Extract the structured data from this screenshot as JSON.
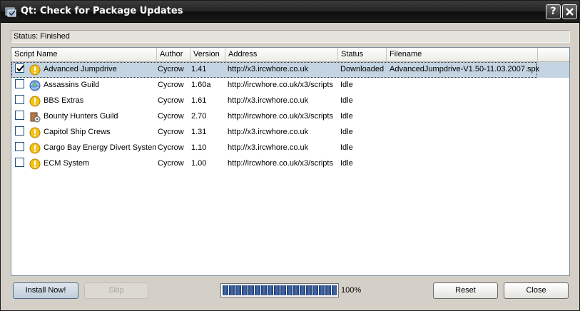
{
  "window": {
    "title": "Qt: Check for Package Updates"
  },
  "status_label": "Status: Finished",
  "columns": [
    "Script Name",
    "Author",
    "Version",
    "Address",
    "Status",
    "Filename"
  ],
  "rows": [
    {
      "checked": true,
      "icon": "info-icon",
      "name": "Advanced Jumpdrive",
      "author": "Cycrow",
      "version": "1.41",
      "address": "http://x3.ircwhore.co.uk",
      "status": "Downloaded",
      "filename": "AdvancedJumpdrive-V1.50-11.03.2007.spk"
    },
    {
      "checked": false,
      "icon": "globe-icon",
      "name": "Assassins Guild",
      "author": "Cycrow",
      "version": "1.60a",
      "address": "http://ircwhore.co.uk/x3/scripts",
      "status": "Idle",
      "filename": ""
    },
    {
      "checked": false,
      "icon": "info-icon",
      "name": "BBS Extras",
      "author": "Cycrow",
      "version": "1.61",
      "address": "http://x3.ircwhore.co.uk",
      "status": "Idle",
      "filename": ""
    },
    {
      "checked": false,
      "icon": "package-icon",
      "name": "Bounty Hunters Guild",
      "author": "Cycrow",
      "version": "2.70",
      "address": "http://ircwhore.co.uk/x3/scripts",
      "status": "Idle",
      "filename": ""
    },
    {
      "checked": false,
      "icon": "info-icon",
      "name": "Capitol Ship Crews",
      "author": "Cycrow",
      "version": "1.31",
      "address": "http://x3.ircwhore.co.uk",
      "status": "Idle",
      "filename": ""
    },
    {
      "checked": false,
      "icon": "info-icon",
      "name": "Cargo Bay Energy Divert System",
      "author": "Cycrow",
      "version": "1.10",
      "address": "http://x3.ircwhore.co.uk",
      "status": "Idle",
      "filename": ""
    },
    {
      "checked": false,
      "icon": "info-icon",
      "name": "ECM System",
      "author": "Cycrow",
      "version": "1.00",
      "address": "http://ircwhore.co.uk/x3/scripts",
      "status": "Idle",
      "filename": ""
    }
  ],
  "buttons": {
    "install": "Install Now!",
    "skip": "Skip",
    "reset": "Reset",
    "close": "Close"
  },
  "progress": {
    "value": 100,
    "label": "100%"
  },
  "colors": {
    "titlebar": "#1b1b1b",
    "selection": "#c4d4e2",
    "progress": "#1f3b6f"
  }
}
